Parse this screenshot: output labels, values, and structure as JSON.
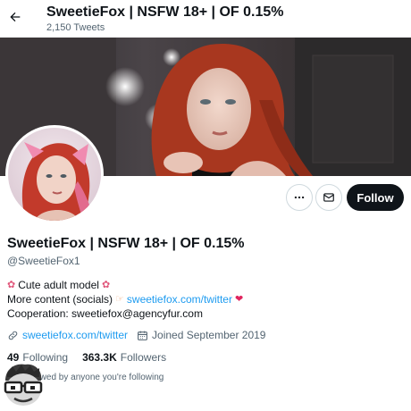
{
  "header": {
    "title": "SweetieFox | NSFW 18+ | OF 0.15%",
    "tweets_count": "2,150 Tweets",
    "back_icon": "arrow-left-icon"
  },
  "profile": {
    "display_name": "SweetieFox | NSFW 18+ | OF 0.15%",
    "handle": "@SweetieFox1",
    "actions": {
      "more_icon": "more-horizontal-icon",
      "message_icon": "envelope-icon",
      "follow_label": "Follow"
    },
    "bio": {
      "line1_text": "Cute adult model",
      "line2_prefix": "More content (socials)",
      "line2_link": "sweetiefox.com/twitter",
      "line3": "Cooperation: sweetiefox@agencyfur.com"
    },
    "meta": {
      "website": "sweetiefox.com/twitter",
      "joined": "Joined September 2019"
    },
    "stats": {
      "following_count": "49",
      "following_label": "Following",
      "followers_count": "363.3K",
      "followers_label": "Followers"
    },
    "followed_note": "Not followed by anyone you're following"
  },
  "colors": {
    "link": "#1d9bf0",
    "text": "#0f1419",
    "secondary": "#536471",
    "follow_bg": "#0f1419"
  }
}
